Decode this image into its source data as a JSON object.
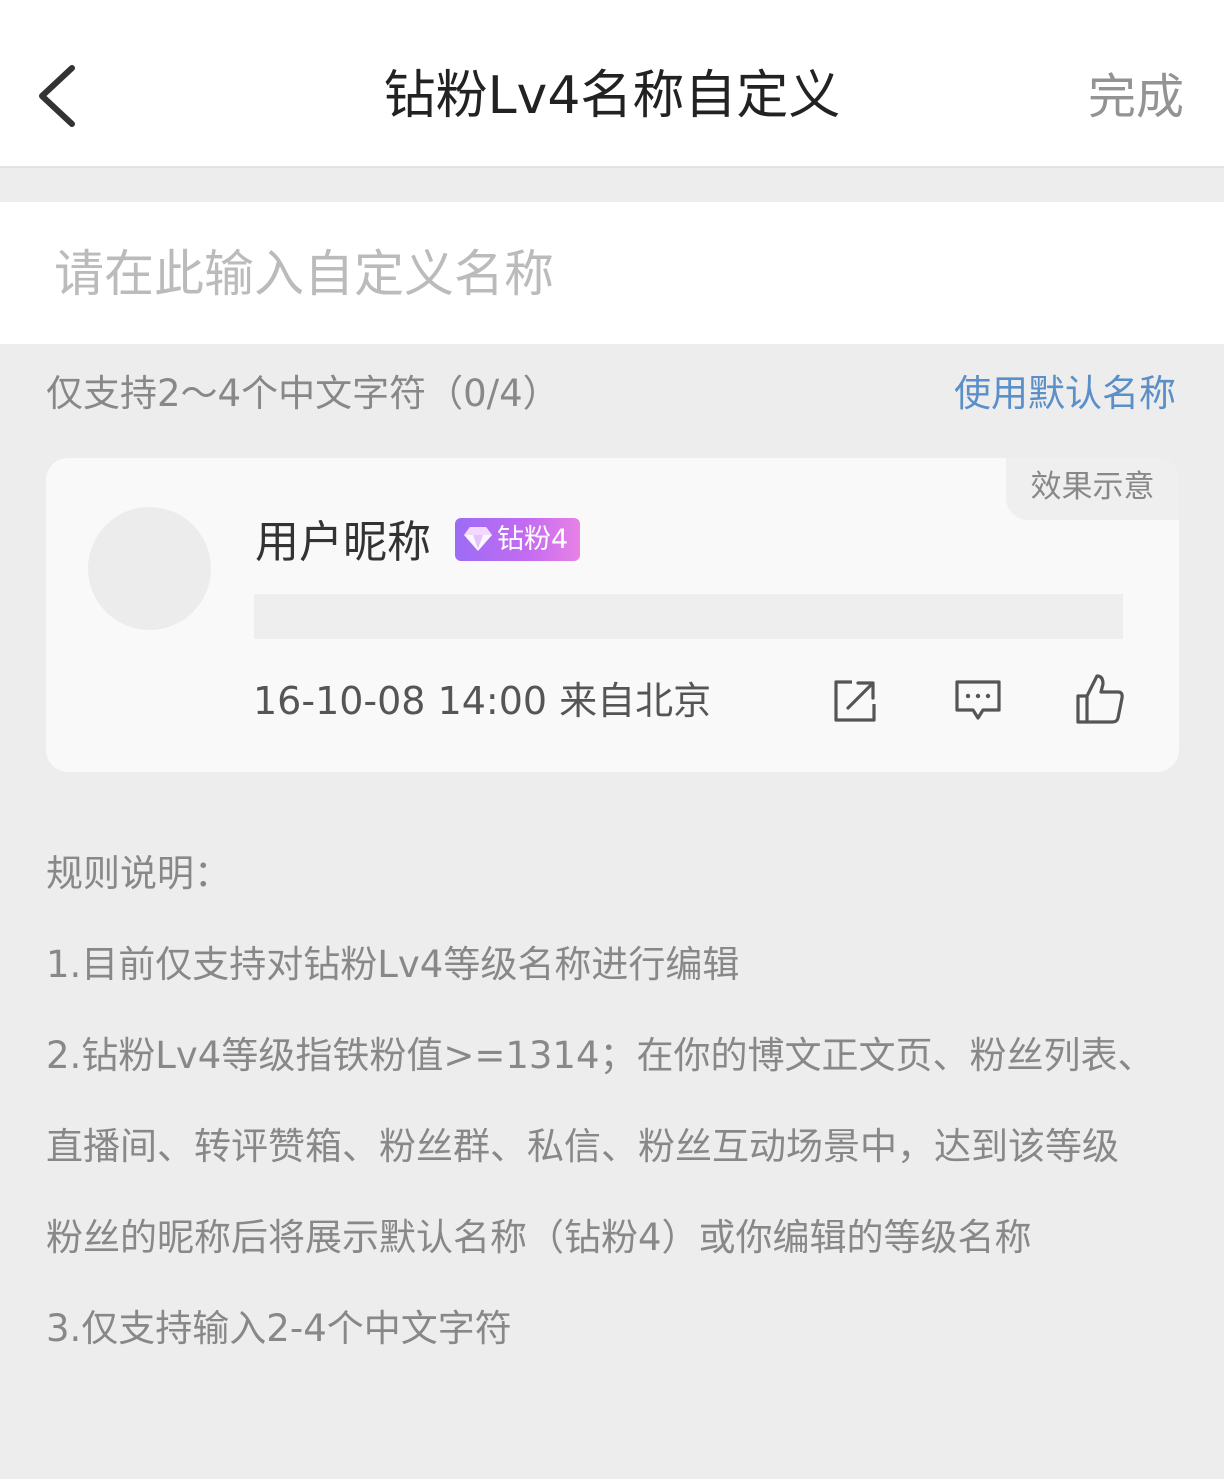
{
  "header": {
    "title": "钻粉Lv4名称自定义",
    "done_label": "完成"
  },
  "name_input": {
    "placeholder": "请在此输入自定义名称",
    "value": ""
  },
  "hint": {
    "text": "仅支持2～4个中文字符（0/4）",
    "default_name_link": "使用默认名称"
  },
  "preview": {
    "tag": "效果示意",
    "nickname": "用户昵称",
    "badge_label": "钻粉4",
    "meta": "16-10-08 14:00 来自北京",
    "icons": [
      "share-icon",
      "comment-icon",
      "like-icon"
    ],
    "badge_colors": [
      "#9b6cf5",
      "#e882e6"
    ]
  },
  "rules": {
    "title": "规则说明：",
    "lines": [
      "1.目前仅支持对钻粉Lv4等级名称进行编辑",
      "2.钻粉Lv4等级指铁粉值>=1314；在你的博文正文页、粉丝列表、",
      "直播间、转评赞箱、粉丝群、私信、粉丝互动场景中，达到该等级",
      "粉丝的昵称后将展示默认名称（钻粉4）或你编辑的等级名称",
      "3.仅支持输入2-4个中文字符"
    ]
  },
  "colors": {
    "link": "#5b8fc7",
    "background": "#ededed"
  }
}
